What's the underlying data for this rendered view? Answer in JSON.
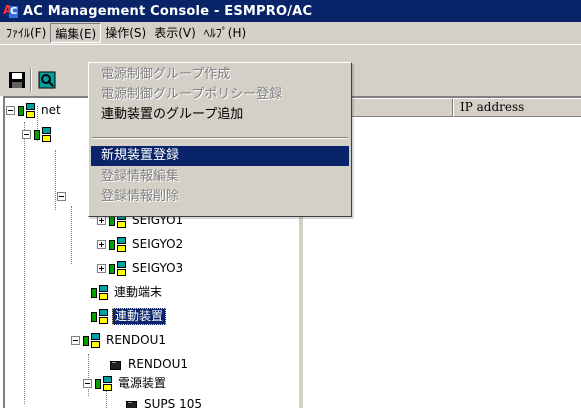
{
  "window": {
    "title": "AC Management Console - ESMPRO/AC"
  },
  "menubar": {
    "items": [
      {
        "label": "ﾌｧｲﾙ(F)"
      },
      {
        "label": "編集(E)"
      },
      {
        "label": "操作(S)"
      },
      {
        "label": "表示(V)"
      },
      {
        "label": "ﾍﾙﾌﾟ(H)"
      }
    ],
    "open_menu": "編集(E)"
  },
  "toolbar": {
    "buttons": [
      "save-icon",
      "refresh-icon"
    ]
  },
  "edit_menu": {
    "items": [
      {
        "label": "電源制御グループ作成",
        "enabled": false
      },
      {
        "label": "電源制御グループポリシー登録",
        "enabled": false
      },
      {
        "label": "連動装置のグループ追加",
        "enabled": true
      },
      {
        "label": "新規装置登録",
        "enabled": true,
        "highlighted": true
      },
      {
        "label": "登録情報編集",
        "enabled": false
      },
      {
        "label": "登録情報削除",
        "enabled": false
      }
    ]
  },
  "tree": {
    "nodes": [
      {
        "label": "net",
        "icon": "group-icon",
        "expanded": true
      },
      {
        "label": "SEIGYO1",
        "icon": "group-icon",
        "expanded": false
      },
      {
        "label": "SEIGYO2",
        "icon": "group-icon",
        "expanded": false
      },
      {
        "label": "SEIGYO3",
        "icon": "group-icon",
        "expanded": false
      },
      {
        "label": "連動端末",
        "icon": "group-icon"
      },
      {
        "label": "連動装置",
        "icon": "group-icon",
        "selected": true
      },
      {
        "label": "RENDOU1",
        "icon": "group-icon",
        "expanded": true
      },
      {
        "label": "RENDOU1",
        "icon": "device-icon"
      },
      {
        "label": "電源装置",
        "icon": "group-icon",
        "expanded": true
      },
      {
        "label": "SUPS 105",
        "icon": "device-icon"
      }
    ]
  },
  "list_view": {
    "columns": [
      {
        "header": "IP address"
      }
    ]
  }
}
